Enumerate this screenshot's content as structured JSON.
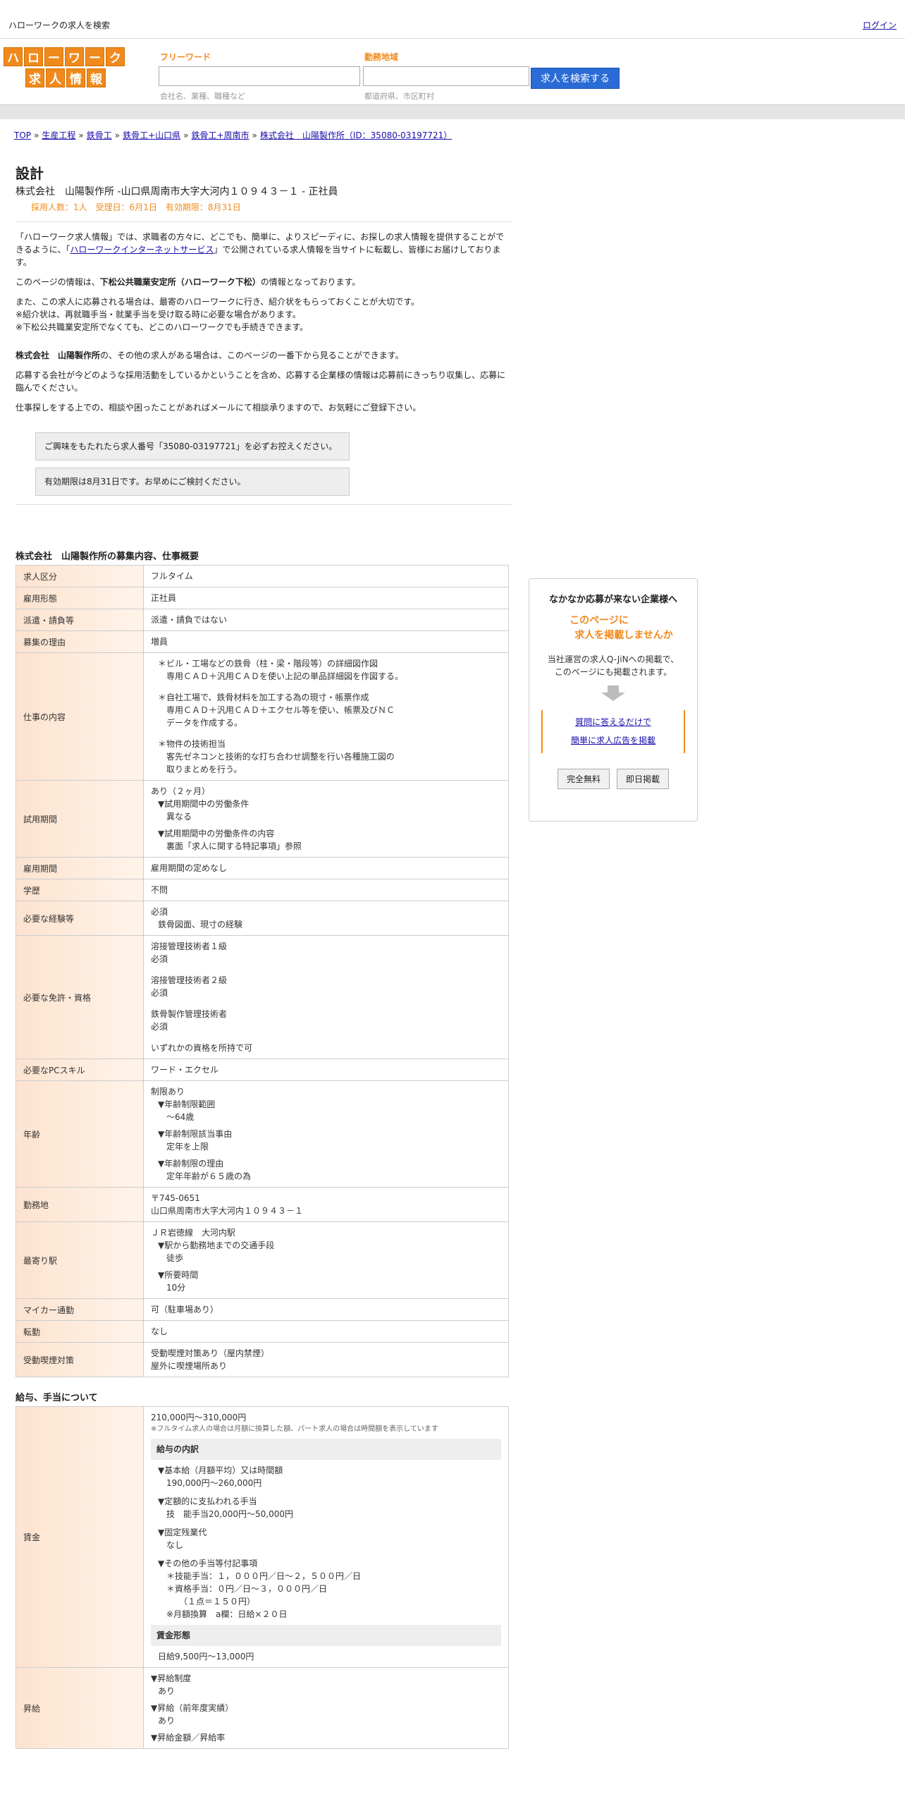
{
  "topbar": {
    "title": "ハローワークの求人を検索",
    "login": "ログイン"
  },
  "logo": {
    "row1": [
      "ハ",
      "ロ",
      "ー",
      "ワ",
      "ー",
      "ク"
    ],
    "row2": [
      "求",
      "人",
      "情",
      "報"
    ]
  },
  "search": {
    "keyword_label": "フリーワード",
    "keyword_hint": "会社名、業種、職種など",
    "area_label": "勤務地域",
    "area_hint": "都道府県、市区町村",
    "button": "求人を検索する"
  },
  "breadcrumb": [
    "TOP",
    "生産工程",
    "鉄骨工",
    "鉄骨工+山口県",
    "鉄骨工+周南市",
    "株式会社　山陽製作所（ID：35080-03197721）"
  ],
  "breadcrumb_sep": "»",
  "job": {
    "title": "設計",
    "company_line": "株式会社　山陽製作所 -山口県周南市大字大河内１０９４３－１ - 正社員",
    "meta": "採用人数：1人　受理日：6月1日　有効期限：8月31日"
  },
  "intro": {
    "p1_pre": "「ハローワーク求人情報」では、求職者の方々に、どこでも、簡単に、よりスピーディに、お探しの求人情報を提供することができるように、「",
    "p1_link": "ハローワークインターネットサービス",
    "p1_post": "」で公開されている求人情報を当サイトに転載し、皆様にお届けしております。",
    "p2_pre": "このページの情報は、",
    "p2_bold": "下松公共職業安定所（ハローワーク下松）",
    "p2_post": "の情報となっております。",
    "p3_l1": "また、この求人に応募される場合は、最寄のハローワークに行き、紹介状をもらっておくことが大切です。",
    "p3_l2": "※紹介状は、再就職手当・就業手当を受け取る時に必要な場合があります。",
    "p3_l3": "※下松公共職業安定所でなくても、どこのハローワークでも手続きできます。",
    "p4_bold": "株式会社　山陽製作所",
    "p4_post": "の、その他の求人がある場合は、このページの一番下から見ることができます。",
    "p5": "応募する会社が今どのような採用活動をしているかということを含め、応募する企業様の情報は応募前にきっちり収集し、応募に臨んでください。",
    "p6": "仕事探しをする上での、相談や困ったことがあればメールにて相談承りますので、お気軽にご登録下さい。"
  },
  "notices": [
    "ご興味をもたれたら求人番号「35080-03197721」を必ずお控えください。",
    "有効期限は8月31日です。お早めにご検討ください。"
  ],
  "section1_title": "株式会社　山陽製作所の募集内容、仕事概要",
  "rows": {
    "kubun": {
      "label": "求人区分",
      "value": "フルタイム"
    },
    "keitai": {
      "label": "雇用形態",
      "value": "正社員"
    },
    "haken": {
      "label": "派遣・請負等",
      "value": "派遣・請負ではない"
    },
    "riyu": {
      "label": "募集の理由",
      "value": "増員"
    },
    "naiyo": {
      "label": "仕事の内容",
      "lines": [
        "＊ビル・工場などの鉄骨（柱・梁・階段等）の詳細図作図",
        "専用ＣＡＤ＋汎用ＣＡＤを使い上記の単品詳細図を作図する。",
        "＊自社工場で、鉄骨材料を加工する為の現寸・帳票作成",
        "専用ＣＡＤ＋汎用ＣＡＤ＋エクセル等を使い、帳票及びＮＣ",
        "データを作成する。",
        "＊物件の技術担当",
        "客先ゼネコンと技術的な打ち合わせ調整を行い各種施工図の",
        "取りまとめを行う。"
      ]
    },
    "shiyo": {
      "label": "試用期間",
      "lines": [
        "あり（２ヶ月）",
        "▼試用期間中の労働条件",
        "異なる",
        "▼試用期間中の労働条件の内容",
        "裏面「求人に関する特記事項」参照"
      ]
    },
    "kikan": {
      "label": "雇用期間",
      "value": "雇用期間の定めなし"
    },
    "gakureki": {
      "label": "学歴",
      "value": "不問"
    },
    "keiken": {
      "label": "必要な経験等",
      "lines": [
        "必須",
        "鉄骨図面、現寸の経験"
      ]
    },
    "menkyo": {
      "label": "必要な免許・資格",
      "lines": [
        "溶接管理技術者１級",
        "必須",
        "溶接管理技術者２級",
        "必須",
        "鉄骨製作管理技術者",
        "必須",
        "いずれかの資格を所持で可"
      ]
    },
    "pc": {
      "label": "必要なPCスキル",
      "value": "ワード・エクセル"
    },
    "nenrei": {
      "label": "年齢",
      "lines": [
        "制限あり",
        "▼年齢制限範囲",
        "〜64歳",
        "▼年齢制限該当事由",
        "定年を上限",
        "▼年齢制限の理由",
        "定年年齢が６５歳の為"
      ]
    },
    "kinmuchi": {
      "label": "勤務地",
      "lines": [
        "〒745-0651",
        "山口県周南市大字大河内１０９４３－１"
      ]
    },
    "eki": {
      "label": "最寄り駅",
      "lines": [
        "ＪＲ岩徳線　大河内駅",
        "▼駅から勤務地までの交通手段",
        "徒歩",
        "▼所要時間",
        "10分"
      ]
    },
    "mycar": {
      "label": "マイカー通勤",
      "value": "可（駐車場あり）"
    },
    "tenkin": {
      "label": "転勤",
      "value": "なし"
    },
    "kitsuen": {
      "label": "受動喫煙対策",
      "lines": [
        "受動喫煙対策あり（屋内禁煙）",
        "屋外に喫煙場所あり"
      ]
    }
  },
  "section2_title": "給与、手当について",
  "wage": {
    "label": "賃金",
    "range": "210,000円〜310,000円",
    "note": "※フルタイム求人の場合は月額に換算した額、パート求人の場合は時間額を表示しています",
    "detail_head": "給与の内訳",
    "detail_lines": [
      "▼基本給（月額平均）又は時間額",
      "190,000円〜260,000円",
      "▼定額的に支払われる手当",
      "技　能手当20,000円〜50,000円",
      "▼固定残業代",
      "なし",
      "▼その他の手当等付記事項",
      "＊技能手当：１，０００円／日〜２，５００円／日",
      "＊資格手当：０円／日〜３，０００円／日",
      "（１点＝１５０円）",
      "※月額換算　a欄：日給×２０日"
    ],
    "form_head": "賃金形態",
    "form_value": "日給9,500円〜13,000円"
  },
  "shokyu": {
    "label": "昇給",
    "lines": [
      "▼昇給制度",
      "あり",
      "▼昇給（前年度実績）",
      "あり",
      "▼昇給金額／昇給率"
    ]
  },
  "sidebox": {
    "heading": "なかなか応募が来ない企業様へ",
    "orange1": "このページに",
    "orange2": "求人を掲載しませんか",
    "desc1": "当社運営の求人Q-JiNへの掲載で、",
    "desc2": "このページにも掲載されます。",
    "link1": "質問に答えるだけで",
    "link2": "簡単に求人広告を掲載",
    "btn1": "完全無料",
    "btn2": "即日掲載"
  }
}
